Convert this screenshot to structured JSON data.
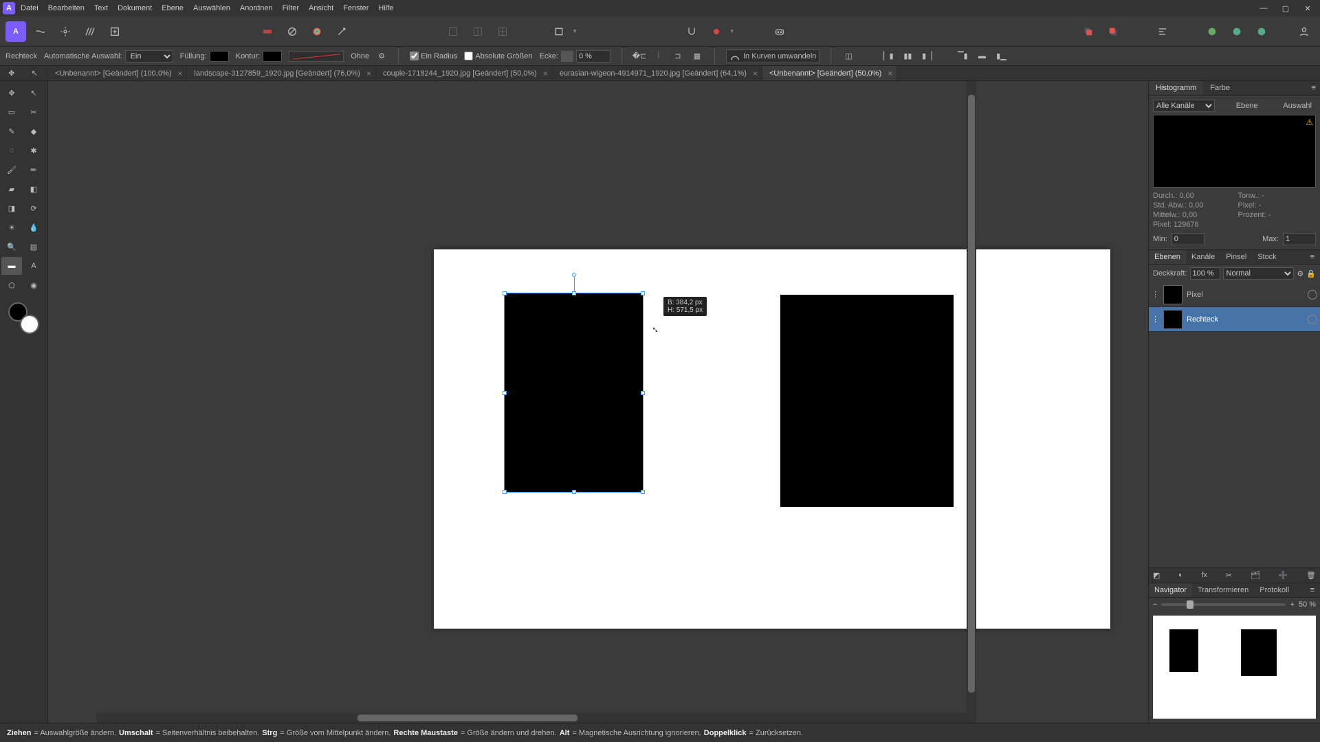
{
  "menu": [
    "Datei",
    "Bearbeiten",
    "Text",
    "Dokument",
    "Ebene",
    "Auswählen",
    "Anordnen",
    "Filter",
    "Ansicht",
    "Fenster",
    "Hilfe"
  ],
  "context": {
    "tool": "Rechteck",
    "autoSelectLabel": "Automatische Auswahl:",
    "autoSelectValue": "Ein",
    "fillLabel": "Füllung:",
    "strokeLabel": "Kontur:",
    "strokeNone": "Ohne",
    "oneRadius": "Ein Radius",
    "absolute": "Absolute Größen",
    "cornerLabel": "Ecke:",
    "cornerValue": "0 %",
    "convert": "In Kurven umwandeln"
  },
  "tabs": [
    {
      "label": "<Unbenannt> [Geändert] (100,0%)",
      "active": false
    },
    {
      "label": "landscape-3127859_1920.jpg [Geändert] (76,0%)",
      "active": false
    },
    {
      "label": "couple-1718244_1920.jpg [Geändert] (50,0%)",
      "active": false
    },
    {
      "label": "eurasian-wigeon-4914971_1920.jpg [Geändert] (64,1%)",
      "active": false
    },
    {
      "label": "<Unbenannt> [Geändert] (50,0%)",
      "active": true
    }
  ],
  "tooltip": {
    "w": "B: 384,2 px",
    "h": "H: 571,5 px"
  },
  "right": {
    "tabs1": [
      "Histogramm",
      "Farbe"
    ],
    "channelLabel": "Alle Kanäle",
    "scopeLayer": "Ebene",
    "scopeSel": "Auswahl",
    "stats": {
      "durch": "Durch.: 0,00",
      "stdabw": "Std. Abw.: 0,00",
      "mittelw": "Mittelw.: 0,00",
      "pix": "Pixel: 129678",
      "tonw": "Tonw.: -",
      "pixel": "Pixel: -",
      "proz": "Prozent: -"
    },
    "minLabel": "Min:",
    "minVal": "0",
    "maxLabel": "Max:",
    "maxVal": "1",
    "tabs2": [
      "Ebenen",
      "Kanäle",
      "Pinsel",
      "Stock"
    ],
    "opacityLabel": "Deckkraft:",
    "opacityVal": "100 %",
    "blend": "Normal",
    "layers": [
      {
        "name": "Pixel",
        "selected": false
      },
      {
        "name": "Rechteck",
        "selected": true
      }
    ],
    "tabs3": [
      "Navigator",
      "Transformieren",
      "Protokoll"
    ],
    "zoom": "50 %"
  },
  "status": [
    {
      "b": "Ziehen",
      "t": " = Auswahlgröße ändern. "
    },
    {
      "b": "Umschalt",
      "t": " = Seitenverhältnis beibehalten. "
    },
    {
      "b": "Strg",
      "t": " = Größe vom Mittelpunkt ändern. "
    },
    {
      "b": "Rechte Maustaste",
      "t": " = Größe ändern und drehen. "
    },
    {
      "b": "Alt",
      "t": " = Magnetische Ausrichtung ignorieren. "
    },
    {
      "b": "Doppelklick",
      "t": " = Zurücksetzen."
    }
  ]
}
